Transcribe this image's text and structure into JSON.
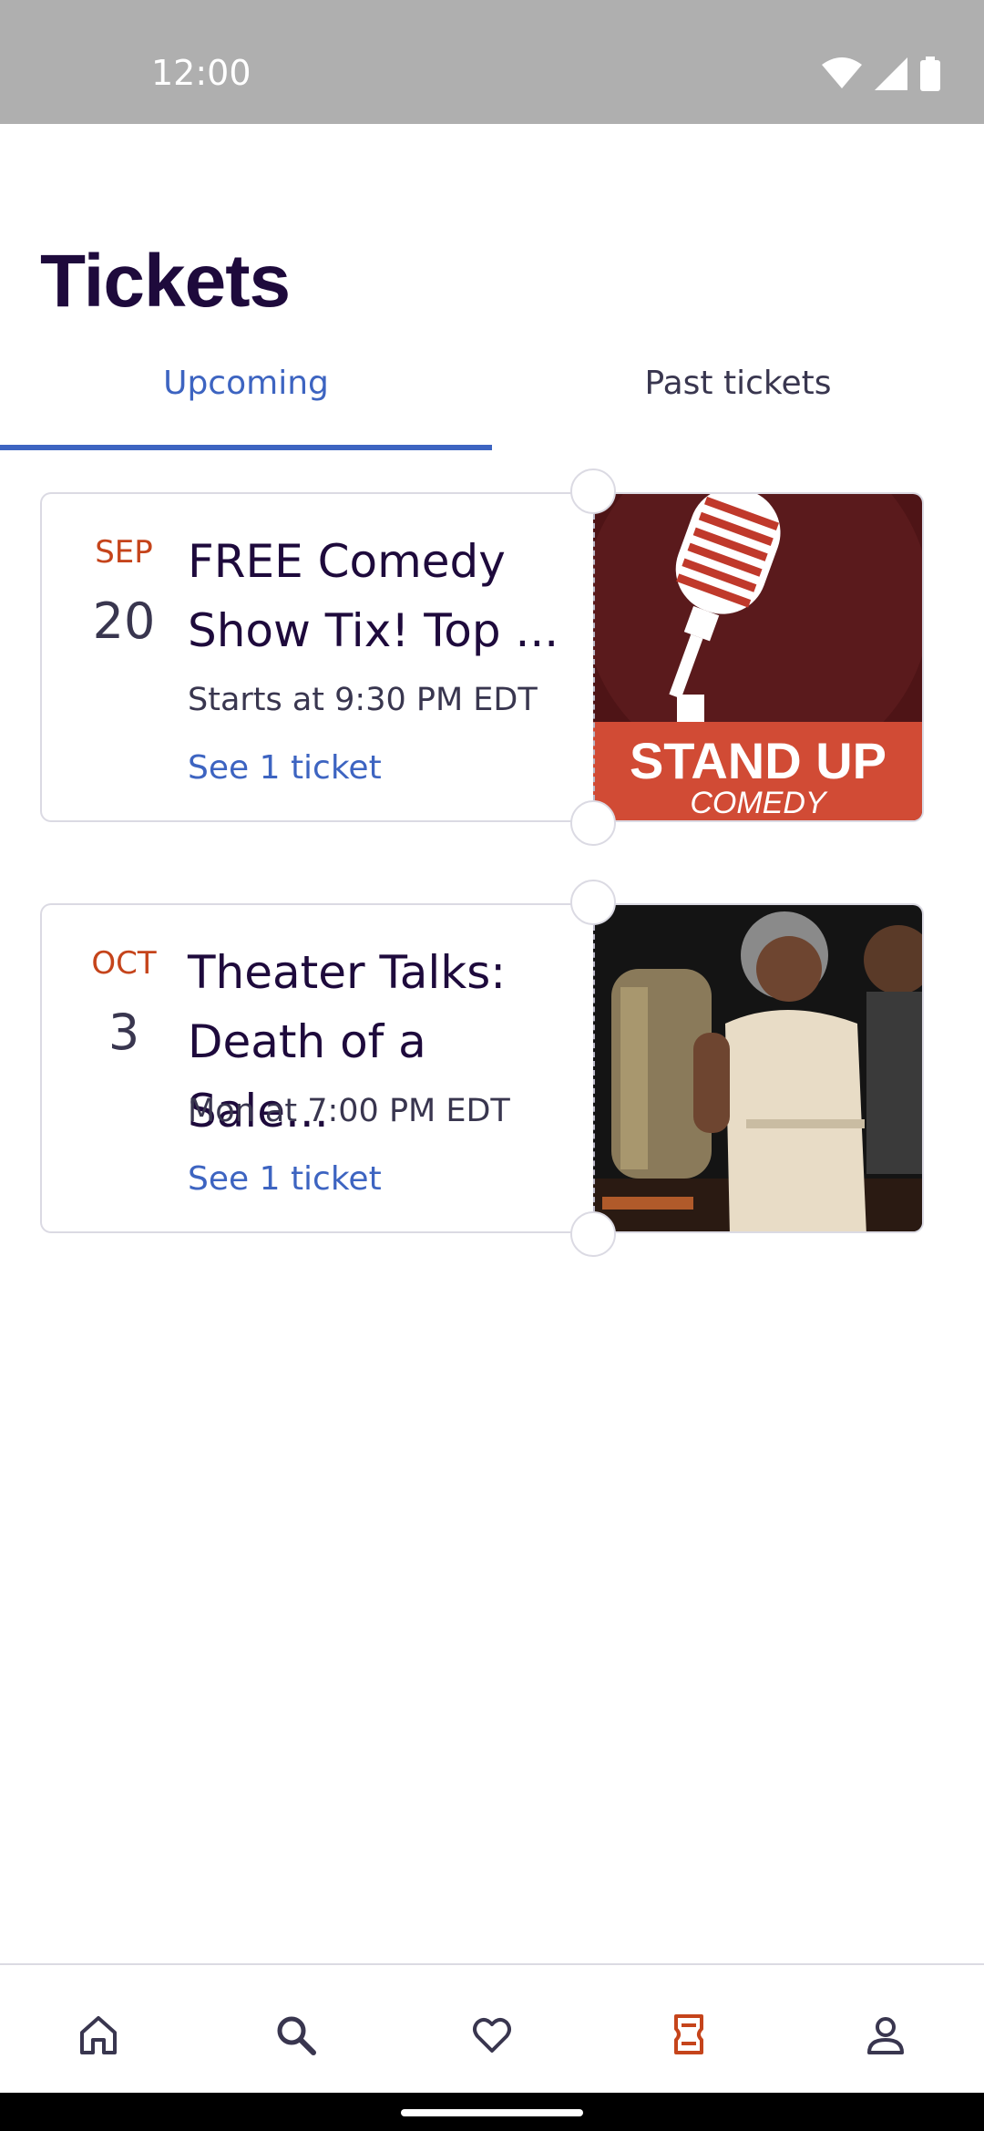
{
  "status_bar": {
    "time": "12:00"
  },
  "page": {
    "title": "Tickets"
  },
  "tabs": [
    {
      "label": "Upcoming",
      "active": true
    },
    {
      "label": "Past tickets",
      "active": false
    }
  ],
  "tickets": [
    {
      "month": "SEP",
      "day": "20",
      "title": "FREE Comedy Show Tix! Top ...",
      "time": "Starts at 9:30 PM EDT",
      "link": "See 1 ticket",
      "image_text_1": "STAND UP",
      "image_text_2": "COMEDY"
    },
    {
      "month": "OCT",
      "day": "3",
      "title": "Theater Talks: Death of a Sale...",
      "time": "Mon at 7:00 PM EDT",
      "link": "See 1 ticket"
    }
  ],
  "bottom_nav": [
    {
      "icon": "home-icon",
      "active": false
    },
    {
      "icon": "search-icon",
      "active": false
    },
    {
      "icon": "heart-icon",
      "active": false
    },
    {
      "icon": "ticket-icon",
      "active": true
    },
    {
      "icon": "profile-icon",
      "active": false
    }
  ],
  "colors": {
    "accent": "#3d64c1",
    "brand_orange": "#c5441b",
    "title": "#1e0a3c"
  }
}
